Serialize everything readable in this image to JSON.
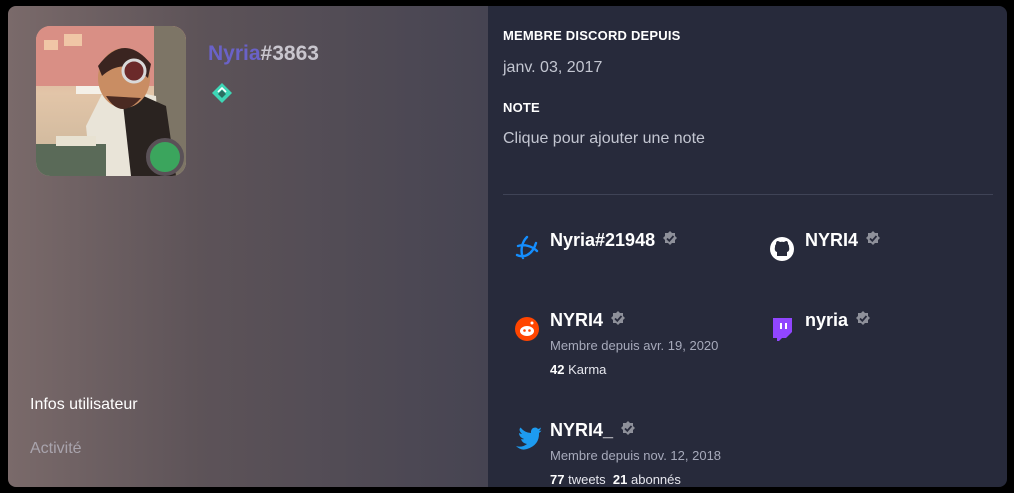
{
  "profile": {
    "username": "Nyria",
    "discriminator": "#3863",
    "status_color": "#3ba55d",
    "badge_icon": "hypesquad-balance-icon"
  },
  "nav": {
    "user_info": "Infos utilisateur",
    "activity": "Activité"
  },
  "member_since": {
    "title": "MEMBRE DISCORD DEPUIS",
    "date": "janv. 03, 2017"
  },
  "note": {
    "title": "NOTE",
    "placeholder": "Clique pour ajouter une note"
  },
  "connections": {
    "battlenet": {
      "name": "Nyria#21948",
      "icon": "battlenet-icon"
    },
    "github": {
      "name": "NYRI4",
      "icon": "github-icon"
    },
    "reddit": {
      "name": "NYRI4",
      "icon": "reddit-icon",
      "member_since": "Membre depuis avr. 19, 2020",
      "karma_value": "42",
      "karma_label": "Karma"
    },
    "twitch": {
      "name": "nyria",
      "icon": "twitch-icon"
    },
    "twitter": {
      "name": "NYRI4_",
      "icon": "twitter-icon",
      "member_since": "Membre depuis nov. 12, 2018",
      "tweets_value": "77",
      "tweets_label": "tweets",
      "followers_value": "21",
      "followers_label": "abonnés"
    }
  },
  "colors": {
    "left_panel": "#5d5358",
    "right_panel": "#272a3b",
    "username": "#6a62c8",
    "reddit": "#ff4500",
    "twitch": "#9146ff",
    "twitter": "#1d9bf0",
    "battlenet": "#148eff"
  }
}
